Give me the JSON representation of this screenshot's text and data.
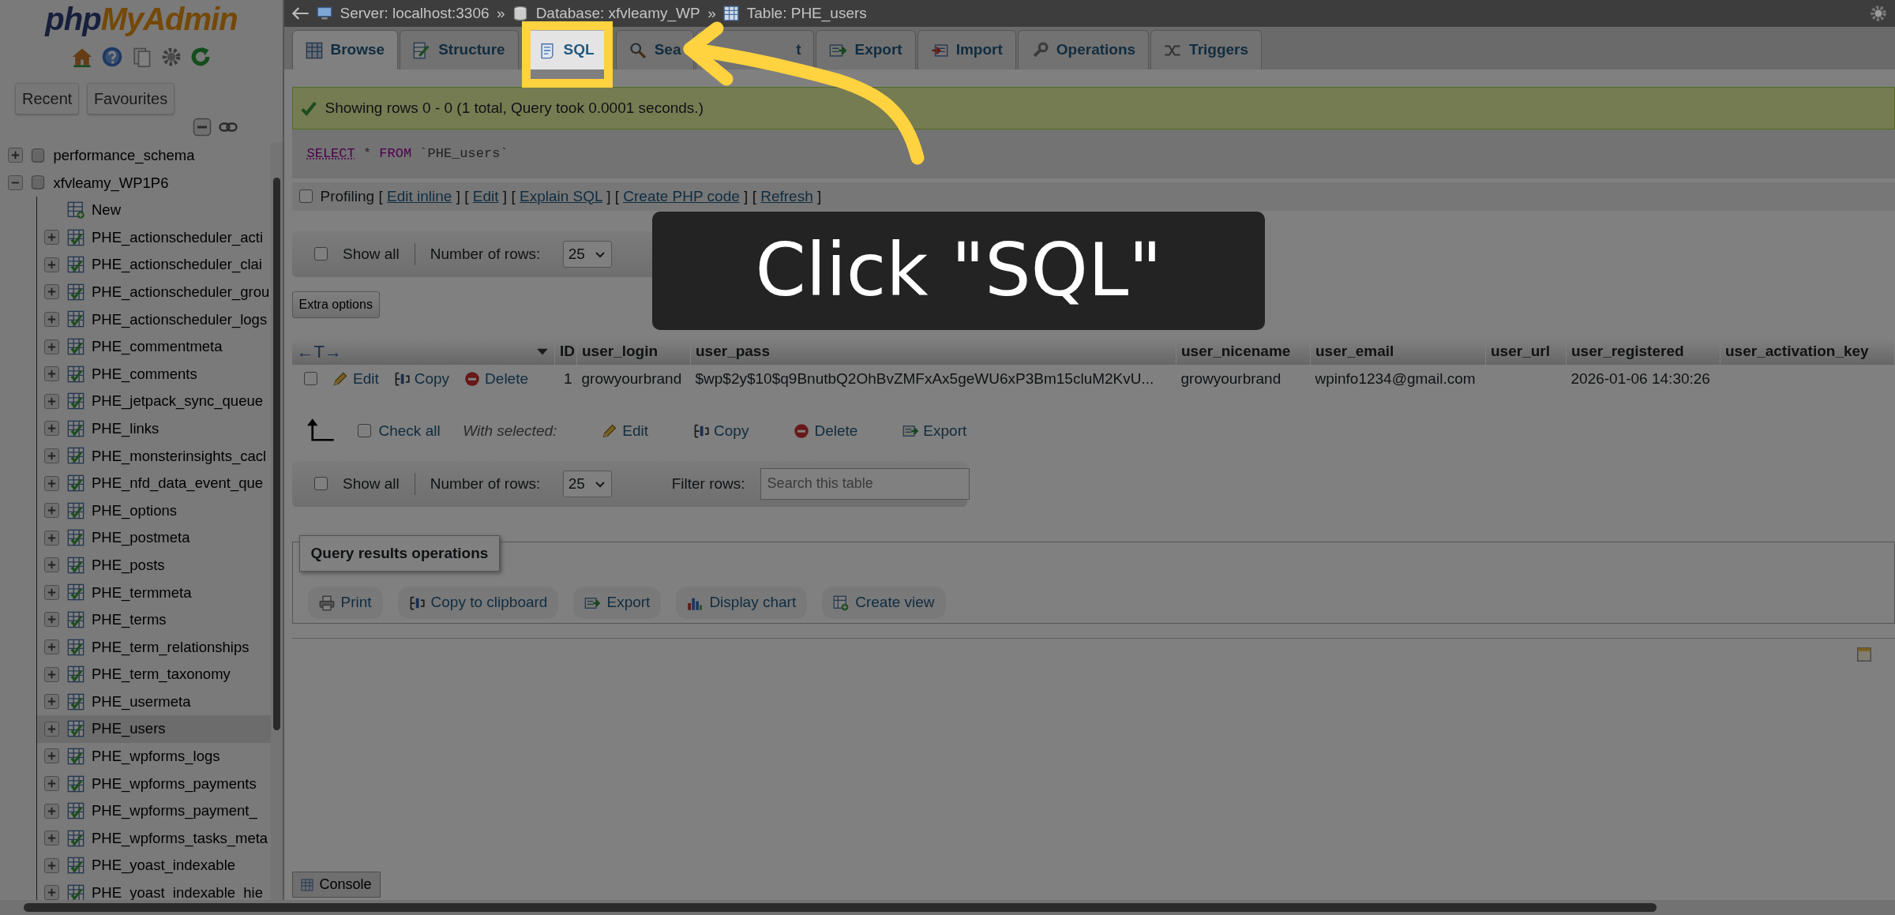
{
  "sidebar": {
    "logo": [
      "php",
      "MyAdmin"
    ],
    "buttons": [
      "Recent",
      "Favourites"
    ],
    "tree": [
      {
        "label": "performance_schema",
        "expanded": false
      },
      {
        "label": "xfvleamy_WP1P6",
        "expanded": true,
        "children": [
          {
            "label": "New",
            "kind": "new",
            "selected": false
          },
          {
            "label": "PHE_actionscheduler_acti",
            "kind": "table",
            "selected": false
          },
          {
            "label": "PHE_actionscheduler_clai",
            "kind": "table",
            "selected": false
          },
          {
            "label": "PHE_actionscheduler_grou",
            "kind": "table",
            "selected": false
          },
          {
            "label": "PHE_actionscheduler_logs",
            "kind": "table",
            "selected": false
          },
          {
            "label": "PHE_commentmeta",
            "kind": "table",
            "selected": false
          },
          {
            "label": "PHE_comments",
            "kind": "table",
            "selected": false
          },
          {
            "label": "PHE_jetpack_sync_queue",
            "kind": "table",
            "selected": false
          },
          {
            "label": "PHE_links",
            "kind": "table",
            "selected": false
          },
          {
            "label": "PHE_monsterinsights_cacl",
            "kind": "table",
            "selected": false
          },
          {
            "label": "PHE_nfd_data_event_que",
            "kind": "table",
            "selected": false
          },
          {
            "label": "PHE_options",
            "kind": "table",
            "selected": false
          },
          {
            "label": "PHE_postmeta",
            "kind": "table",
            "selected": false
          },
          {
            "label": "PHE_posts",
            "kind": "table",
            "selected": false
          },
          {
            "label": "PHE_termmeta",
            "kind": "table",
            "selected": false
          },
          {
            "label": "PHE_terms",
            "kind": "table",
            "selected": false
          },
          {
            "label": "PHE_term_relationships",
            "kind": "table",
            "selected": false
          },
          {
            "label": "PHE_term_taxonomy",
            "kind": "table",
            "selected": false
          },
          {
            "label": "PHE_usermeta",
            "kind": "table",
            "selected": false
          },
          {
            "label": "PHE_users",
            "kind": "table",
            "selected": true
          },
          {
            "label": "PHE_wpforms_logs",
            "kind": "table",
            "selected": false
          },
          {
            "label": "PHE_wpforms_payments",
            "kind": "table",
            "selected": false
          },
          {
            "label": "PHE_wpforms_payment_",
            "kind": "table",
            "selected": false
          },
          {
            "label": "PHE_wpforms_tasks_meta",
            "kind": "table",
            "selected": false
          },
          {
            "label": "PHE_yoast_indexable",
            "kind": "table",
            "selected": false
          },
          {
            "label": "PHE_yoast_indexable_hie",
            "kind": "table",
            "selected": false
          }
        ]
      }
    ]
  },
  "breadcrumb": [
    {
      "label": "Server: localhost:3306"
    },
    {
      "separator": "»",
      "label": "Database: xfvleamy_WP"
    },
    {
      "separator": "»",
      "label": "Table: PHE_users"
    }
  ],
  "tabs": [
    {
      "label": "Browse",
      "selected": true,
      "highlighted": false
    },
    {
      "label": "Structure",
      "selected": false,
      "highlighted": false
    },
    {
      "label": "SQL",
      "selected": false,
      "highlighted": true
    },
    {
      "label": "Sea",
      "selected": false,
      "highlighted": false
    },
    {
      "label": "t",
      "selected": false,
      "highlighted": false
    },
    {
      "label": "Export",
      "selected": false,
      "highlighted": false
    },
    {
      "label": "Import",
      "selected": false,
      "highlighted": false
    },
    {
      "label": "Operations",
      "selected": false,
      "highlighted": false
    },
    {
      "label": "Triggers",
      "selected": false,
      "highlighted": false
    }
  ],
  "tutorial_callout": "Click \"SQL\"",
  "message": "Showing rows 0 - 0 (1 total, Query took 0.0001 seconds.)",
  "sql_query": [
    {
      "text": "SELECT",
      "kind": "keyword"
    },
    {
      "text": "*",
      "kind": "operator"
    },
    {
      "text": "FROM",
      "kind": "keyword"
    },
    {
      "text": "`PHE_users`",
      "kind": "identifier"
    }
  ],
  "profiling": {
    "label": "Profiling",
    "checked": false,
    "links": [
      {
        "open": "[",
        "label": "Edit inline",
        "close": "]"
      },
      {
        "open": "[",
        "label": "Edit",
        "close": "]"
      },
      {
        "open": "[",
        "label": "Explain SQL",
        "close": "]"
      },
      {
        "open": "[",
        "label": "Create PHP code",
        "close": "]"
      },
      {
        "open": "[",
        "label": "Refresh",
        "close": "]"
      }
    ]
  },
  "top_nav": {
    "show_all": {
      "label": "Show all",
      "checked": false
    },
    "rows_label": "Number of rows:",
    "rows_value": "25"
  },
  "extra_options": "Extra options",
  "table": {
    "column_controls": "←T→",
    "columns": [
      "ID",
      "user_login",
      "user_pass",
      "user_nicename",
      "user_email",
      "user_url",
      "user_registered",
      "user_activation_key"
    ],
    "rows": [
      {
        "checked": false,
        "actions": [
          "Edit",
          "Copy",
          "Delete"
        ],
        "cells": [
          "1",
          "growyourbrand",
          "$wp$2y$10$q9BnutbQ2OhBvZMFxAx5geWU6xP3Bm15cluM2KvU...",
          "growyourbrand",
          "wpinfo1234@gmail.com",
          null,
          "2026-01-06 14:30:26",
          null
        ]
      }
    ]
  },
  "bulk": {
    "check_all": {
      "label": "Check all",
      "checked": false
    },
    "with_selected": "With selected:",
    "actions": [
      "Edit",
      "Copy",
      "Delete",
      "Export"
    ]
  },
  "bottom_nav": {
    "show_all": {
      "label": "Show all",
      "checked": false
    },
    "rows_label": "Number of rows:",
    "rows_value": "25",
    "filter_label": "Filter rows:",
    "filter_placeholder": "Search this table"
  },
  "operations": {
    "title": "Query results operations",
    "actions": [
      "Print",
      "Copy to clipboard",
      "Export",
      "Display chart",
      "Create view"
    ]
  },
  "console": "Console"
}
